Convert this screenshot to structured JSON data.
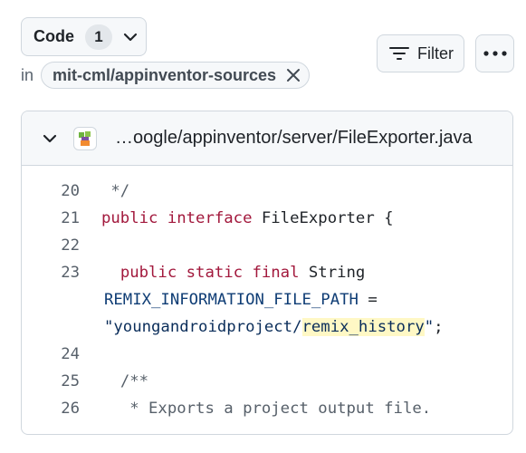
{
  "code_button": {
    "label": "Code",
    "count": "1"
  },
  "scope": {
    "prefix": "in",
    "repo": "mit-cml/appinventor-sources"
  },
  "filter_button": {
    "label": "Filter"
  },
  "result": {
    "path": "…oogle/appinventor/server/FileExporter.java",
    "lines": [
      {
        "num": "20",
        "text": " */"
      },
      {
        "num": "21",
        "kw": "public interface",
        "rest": " FileExporter {"
      },
      {
        "num": "22",
        "text": ""
      },
      {
        "num": "23",
        "kw": "public static final",
        "rest": " String"
      },
      {
        "const": "REMIX_INFORMATION_FILE_PATH",
        "eq": " ="
      },
      {
        "str_pre": "\"youngandroidproject/",
        "str_hl": "remix_history",
        "str_post": "\"",
        "end": ";"
      },
      {
        "num": "24",
        "text": ""
      },
      {
        "num": "25",
        "text": "/**"
      },
      {
        "num": "26",
        "text": " * Exports a project output file."
      }
    ]
  },
  "colors": {
    "keyword": "#a2183c",
    "constant": "#0f3d75",
    "highlight": "#fff8c5",
    "border": "#d0d7de",
    "button_bg": "#f6f8fa"
  },
  "icons": [
    "chevron-down-icon",
    "close-icon",
    "filter-icon",
    "kebab-icon",
    "repo-avatar-icon"
  ]
}
